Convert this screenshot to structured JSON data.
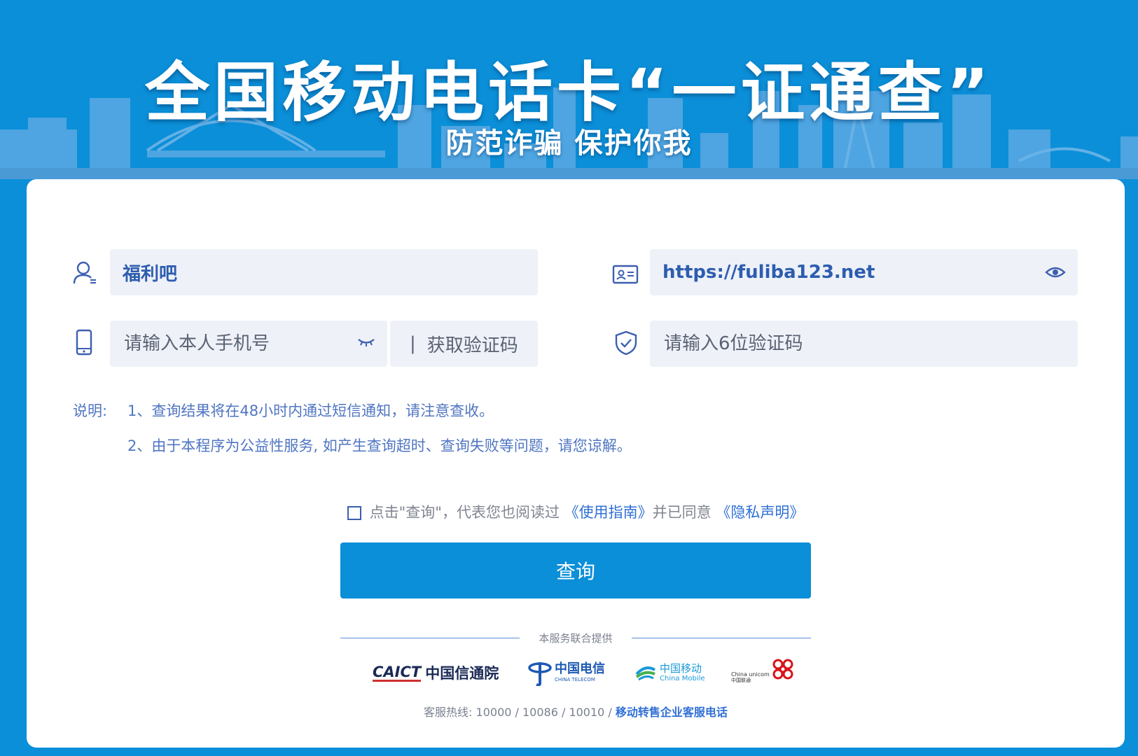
{
  "banner": {
    "title": "全国移动电话卡“一证通查”",
    "subtitle": "防范诈骗 保护你我"
  },
  "form": {
    "name_value": "福利吧",
    "id_value": "https://fuliba123.net",
    "phone_placeholder": "请输入本人手机号",
    "get_code_label": "获取验证码",
    "code_placeholder": "请输入6位验证码"
  },
  "notes": {
    "label": "说明:",
    "line1": "1、查询结果将在48小时内通过短信通知，请注意查收。",
    "line2": "2、由于本程序为公益性服务, 如产生查询超时、查询失败等问题，请您谅解。"
  },
  "agreement": {
    "prefix": "点击\"查询\"，代表您也阅读过",
    "guide_link": "《使用指南》",
    "middle": "并已同意",
    "privacy_link": "《隐私声明》"
  },
  "submit_label": "查询",
  "provided_by": "本服务联合提供",
  "providers": {
    "caict_en": "CAICT",
    "caict_cn": "中国信通院",
    "telecom_cn": "中国电信",
    "telecom_en": "CHINA TELECOM",
    "mobile_cn": "中国移动",
    "mobile_en": "China Mobile",
    "unicom_en": "China unicom",
    "unicom_cn": "中国联通"
  },
  "hotline": {
    "prefix": "客服热线: 10000 / 10086 / 10010 / ",
    "strong": "移动转售企业客服电话"
  },
  "colors": {
    "brand_blue": "#0b8fd8",
    "field_bg": "#eef1f8",
    "text_blue": "#2d5daf",
    "link_blue": "#2f6fd6"
  }
}
